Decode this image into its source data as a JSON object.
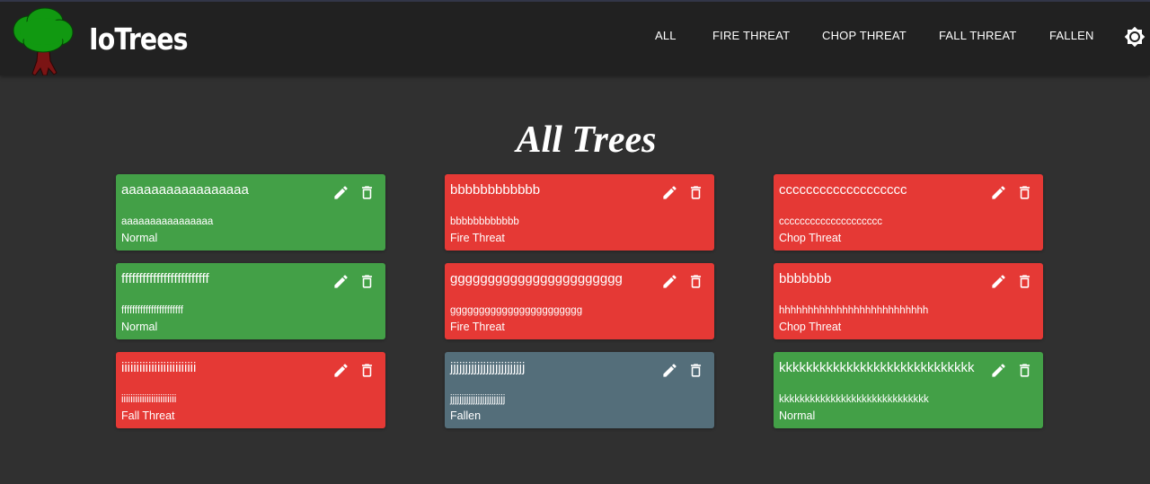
{
  "app": {
    "brand": "IoTrees"
  },
  "nav": {
    "links": [
      "ALL",
      "FIRE THREAT",
      "CHOP THREAT",
      "FALL THREAT",
      "FALLEN"
    ]
  },
  "page": {
    "title": "All Trees"
  },
  "colors": {
    "normal": "#43a047",
    "threat": "#e53935",
    "fallen": "#546e7a",
    "background": "#303030",
    "header": "#212121"
  },
  "trees": [
    {
      "name": "aaaaaaaaaaaaaaaaa",
      "description": "aaaaaaaaaaaaaaaa",
      "status": "Normal",
      "state": "normal"
    },
    {
      "name": "bbbbbbbbbbbb",
      "description": "bbbbbbbbbbbb",
      "status": "Fire Threat",
      "state": "threat"
    },
    {
      "name": "ccccccccccccccccccc",
      "description": "cccccccccccccccccccc",
      "status": "Chop Threat",
      "state": "threat"
    },
    {
      "name": "fffffffffffffffffffffffff",
      "description": "fffffffffffffffffffffff",
      "status": "Normal",
      "state": "normal"
    },
    {
      "name": "ggggggggggggggggggggggg",
      "description": "ggggggggggggggggggggggg",
      "status": "Fire Threat",
      "state": "threat"
    },
    {
      "name": "bbbbbbb",
      "description": "hhhhhhhhhhhhhhhhhhhhhhhhhh",
      "status": "Chop Threat",
      "state": "threat"
    },
    {
      "name": "iiiiiiiiiiiiiiiiiiiiiiiii",
      "description": "iiiiiiiiiiiiiiiiiiiiiiii",
      "status": "Fall Threat",
      "state": "threat"
    },
    {
      "name": "jjjjjjjjjjjjjjjjjjjjjjjjj",
      "description": "jjjjjjjjjjjjjjjjjjjjjjjj",
      "status": "Fallen",
      "state": "fallen"
    },
    {
      "name": "kkkkkkkkkkkkkkkkkkkkkkkkkkkkk",
      "description": "kkkkkkkkkkkkkkkkkkkkkkkkkkkkk",
      "status": "Normal",
      "state": "normal"
    }
  ],
  "icons": {
    "logo": "tree-icon",
    "theme": "brightness-icon",
    "edit": "pencil-icon",
    "delete": "trash-icon"
  }
}
